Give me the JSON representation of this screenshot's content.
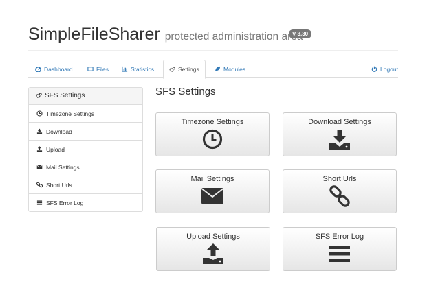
{
  "header": {
    "title": "SimpleFileSharer",
    "subtitle": "protected administration area",
    "version": "V 3.30"
  },
  "tabs": {
    "dashboard": "Dashboard",
    "files": "Files",
    "statistics": "Statistics",
    "settings": "Settings",
    "modules": "Modules",
    "logout": "Logout"
  },
  "sidebar": {
    "title": "SFS Settings",
    "items": [
      "Timezone Settings",
      "Download",
      "Upload",
      "Mail Settings",
      "Short Urls",
      "SFS Error Log"
    ]
  },
  "main": {
    "title": "SFS Settings",
    "cards": [
      "Timezone Settings",
      "Download Settings",
      "Mail Settings",
      "Short Urls",
      "Upload Settings",
      "SFS Error Log"
    ]
  },
  "colors": {
    "link": "#337ab7",
    "icon": "#333333"
  }
}
